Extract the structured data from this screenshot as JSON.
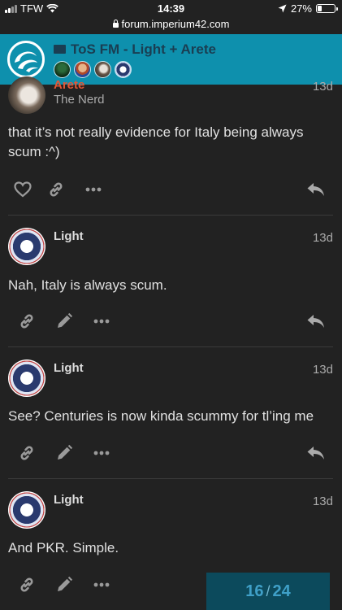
{
  "status_bar": {
    "carrier": "TFW",
    "time": "14:39",
    "battery": "27%",
    "battery_level": 0.27
  },
  "browser": {
    "url": "forum.imperium42.com"
  },
  "topic": {
    "title": "ToS FM - Light + Arete",
    "participant_count": 4
  },
  "posts": [
    {
      "username": "Arete",
      "user_title": "The Nerd",
      "date": "13d",
      "body": "that it’s not really evidence for Italy being always scum :^)"
    },
    {
      "username": "Light",
      "date": "13d",
      "body": "Nah, Italy is always scum."
    },
    {
      "username": "Light",
      "date": "13d",
      "body": "See? Centuries is now kinda scummy for tl’ing me"
    },
    {
      "username": "Light",
      "date": "13d",
      "body": "And PKR. Simple."
    }
  ],
  "progress": {
    "current": "16",
    "separator": "/",
    "total": "24"
  },
  "colors": {
    "header_bg": "#0e90ad",
    "page_bg": "#222222",
    "arete_name": "#e45735",
    "progress_bg": "#0c4a5c"
  }
}
